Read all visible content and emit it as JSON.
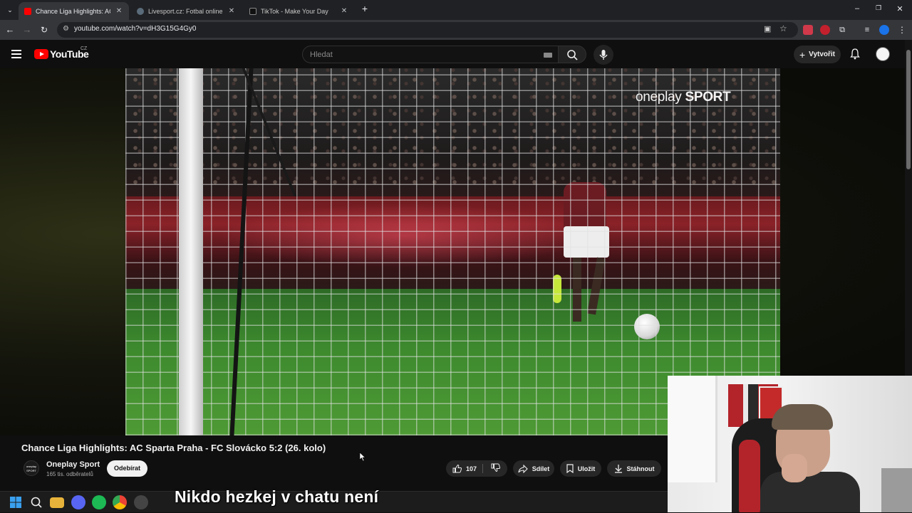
{
  "browser": {
    "tabs": [
      {
        "label": "Chance Liga Highlights: AC Sparta Praha - FC Slovácko",
        "active": true,
        "favicon": "youtube-favicon"
      },
      {
        "label": "Livesport.cz: Fotbal online, fotbalové",
        "active": false,
        "favicon": "livesport-favicon"
      },
      {
        "label": "TikTok - Make Your Day",
        "active": false,
        "favicon": "tiktok-favicon"
      }
    ],
    "url": "youtube.com/watch?v=dH3G15G4Gy0"
  },
  "youtube": {
    "logo_text": "YouTube",
    "country_code": "CZ",
    "search_placeholder": "Hledat",
    "create_label": "Vytvořit"
  },
  "video": {
    "watermark_light": "oneplay",
    "watermark_bold": "SPORT",
    "title": "Chance Liga Highlights: AC Sparta Praha - FC Slovácko 5:2 (26. kolo)",
    "channel": {
      "name": "Oneplay Sport",
      "subscribers": "165 tis. odběratelů",
      "avatar_text": "oneplay SPORT"
    },
    "subscribe_label": "Odebírat",
    "likes": "107",
    "share_label": "Sdílet",
    "save_label": "Uložit",
    "download_label": "Stáhnout"
  },
  "overlay": {
    "caption": "Nikdo hezkej v chatu není"
  },
  "colors": {
    "youtube_red": "#ff0000",
    "background": "#0f0f0f",
    "pill": "#272727"
  }
}
